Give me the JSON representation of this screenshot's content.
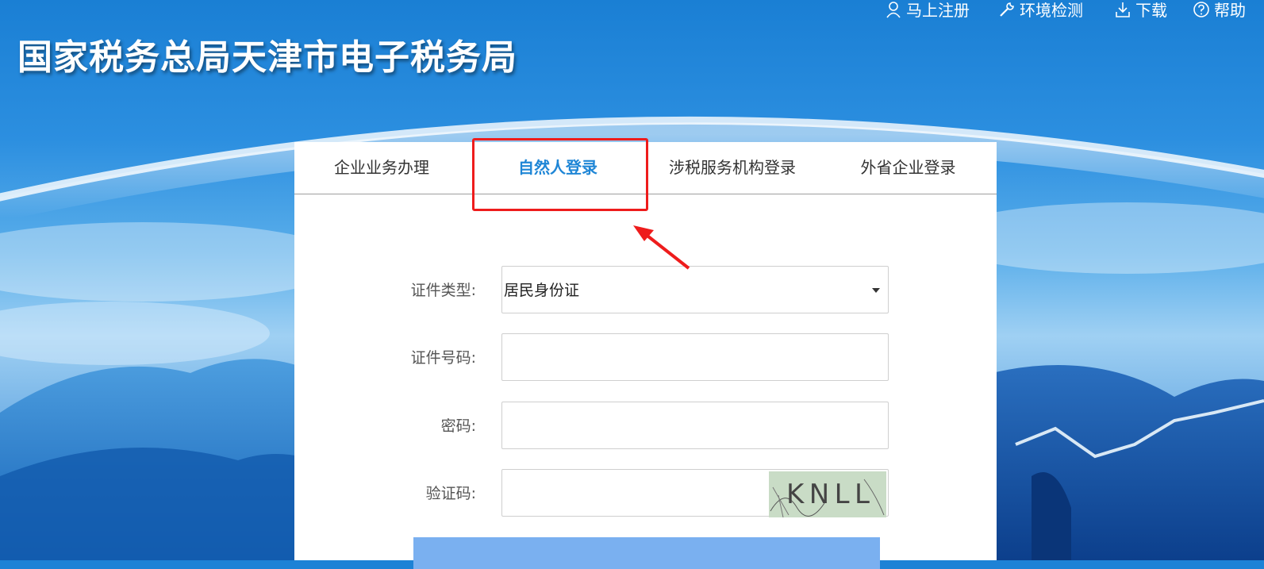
{
  "site": {
    "title": "国家税务总局天津市电子税务局"
  },
  "top_nav": [
    {
      "label": "马上注册",
      "icon": "user-icon"
    },
    {
      "label": "环境检测",
      "icon": "wrench-icon"
    },
    {
      "label": "下载",
      "icon": "download-icon"
    },
    {
      "label": "帮助",
      "icon": "help-icon"
    }
  ],
  "tabs": [
    {
      "label": "企业业务办理",
      "active": false
    },
    {
      "label": "自然人登录",
      "active": true
    },
    {
      "label": "涉税服务机构登录",
      "active": false
    },
    {
      "label": "外省企业登录",
      "active": false
    }
  ],
  "form": {
    "id_type_label": "证件类型:",
    "id_type_value": "居民身份证",
    "id_number_label": "证件号码:",
    "id_number_value": "",
    "password_label": "密码:",
    "password_value": "",
    "captcha_label": "验证码:",
    "captcha_value": "",
    "captcha_text": "KNLL"
  },
  "colors": {
    "accent": "#1f86d6",
    "highlight": "#ee1c1c",
    "submit": "#7ab0f0"
  }
}
